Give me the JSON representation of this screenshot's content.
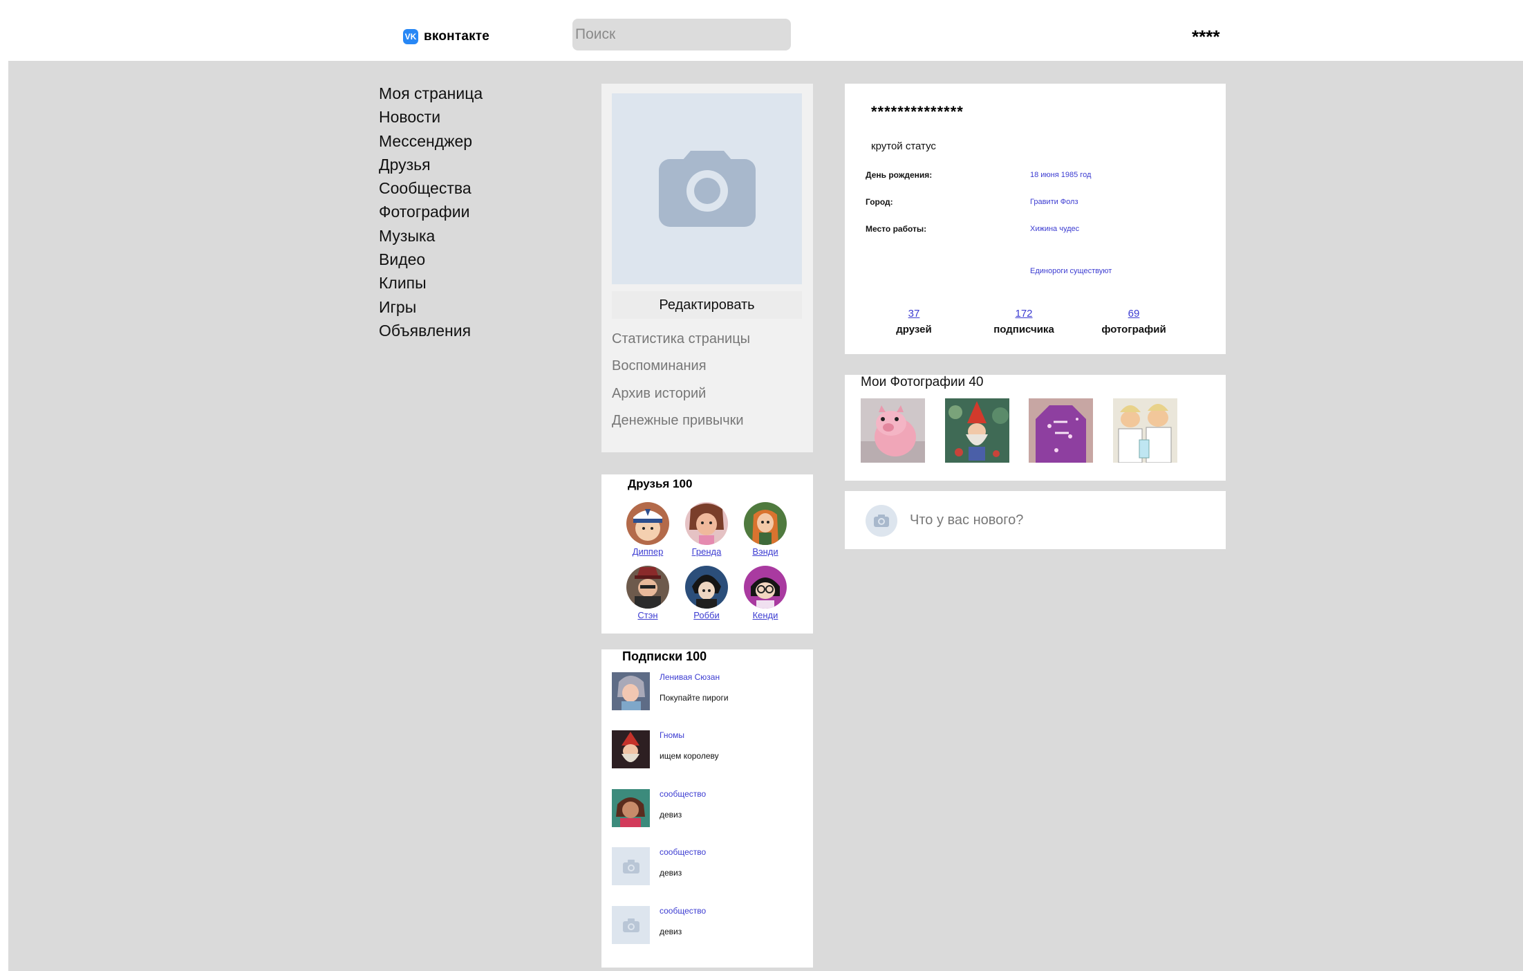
{
  "header": {
    "logo_text": "вконтакте",
    "logo_mark": "VK",
    "search_placeholder": "Поиск",
    "user_name": "****"
  },
  "nav": {
    "items": [
      {
        "label": "Моя страница"
      },
      {
        "label": "Новости"
      },
      {
        "label": "Мессенджер"
      },
      {
        "label": "Друзья"
      },
      {
        "label": "Сообщества"
      },
      {
        "label": "Фотографии"
      },
      {
        "label": "Музыка"
      },
      {
        "label": "Видео"
      },
      {
        "label": "Клипы"
      },
      {
        "label": "Игры"
      },
      {
        "label": "Объявления"
      }
    ]
  },
  "profile": {
    "avatar_icon": "camera-icon",
    "edit_label": "Редактировать",
    "links": [
      {
        "label": "Статистика страницы"
      },
      {
        "label": "Воспоминания"
      },
      {
        "label": "Архив историй"
      },
      {
        "label": "Денежные привычки"
      }
    ]
  },
  "info": {
    "name": "**************",
    "status": "крутой статус",
    "rows": [
      {
        "label": "День рождения:",
        "value": "18 июня 1985 год"
      },
      {
        "label": "Город:",
        "value": "Гравити Фолз"
      },
      {
        "label": "Место работы:",
        "value": "Хижина чудес"
      }
    ],
    "extra": "Единороги существуют",
    "stats": [
      {
        "count": "37",
        "label": "друзей"
      },
      {
        "count": "172",
        "label": "подписчика"
      },
      {
        "count": "69",
        "label": "фотографий"
      }
    ]
  },
  "photos": {
    "title": "Мои Фотографии 40"
  },
  "post": {
    "placeholder": "Что у вас нового?",
    "icon": "camera-icon"
  },
  "friends": {
    "title": "Друзья 100",
    "items": [
      {
        "name": "Диппер"
      },
      {
        "name": "Гренда"
      },
      {
        "name": "Вэнди"
      },
      {
        "name": "Стэн"
      },
      {
        "name": "Робби"
      },
      {
        "name": "Кенди"
      }
    ]
  },
  "subscriptions": {
    "title": "Подписки 100",
    "items": [
      {
        "name": "Ленивая Сюзан",
        "desc": "Покупайте пироги"
      },
      {
        "name": "Гномы",
        "desc": "ищем королеву"
      },
      {
        "name": "сообщество",
        "desc": "девиз"
      },
      {
        "name": "сообщество",
        "desc": "девиз"
      },
      {
        "name": "сообщество",
        "desc": "девиз"
      }
    ]
  },
  "colors": {
    "accent": "#2787f5",
    "link": "#3b3bd1",
    "page_bg": "#dadada"
  }
}
